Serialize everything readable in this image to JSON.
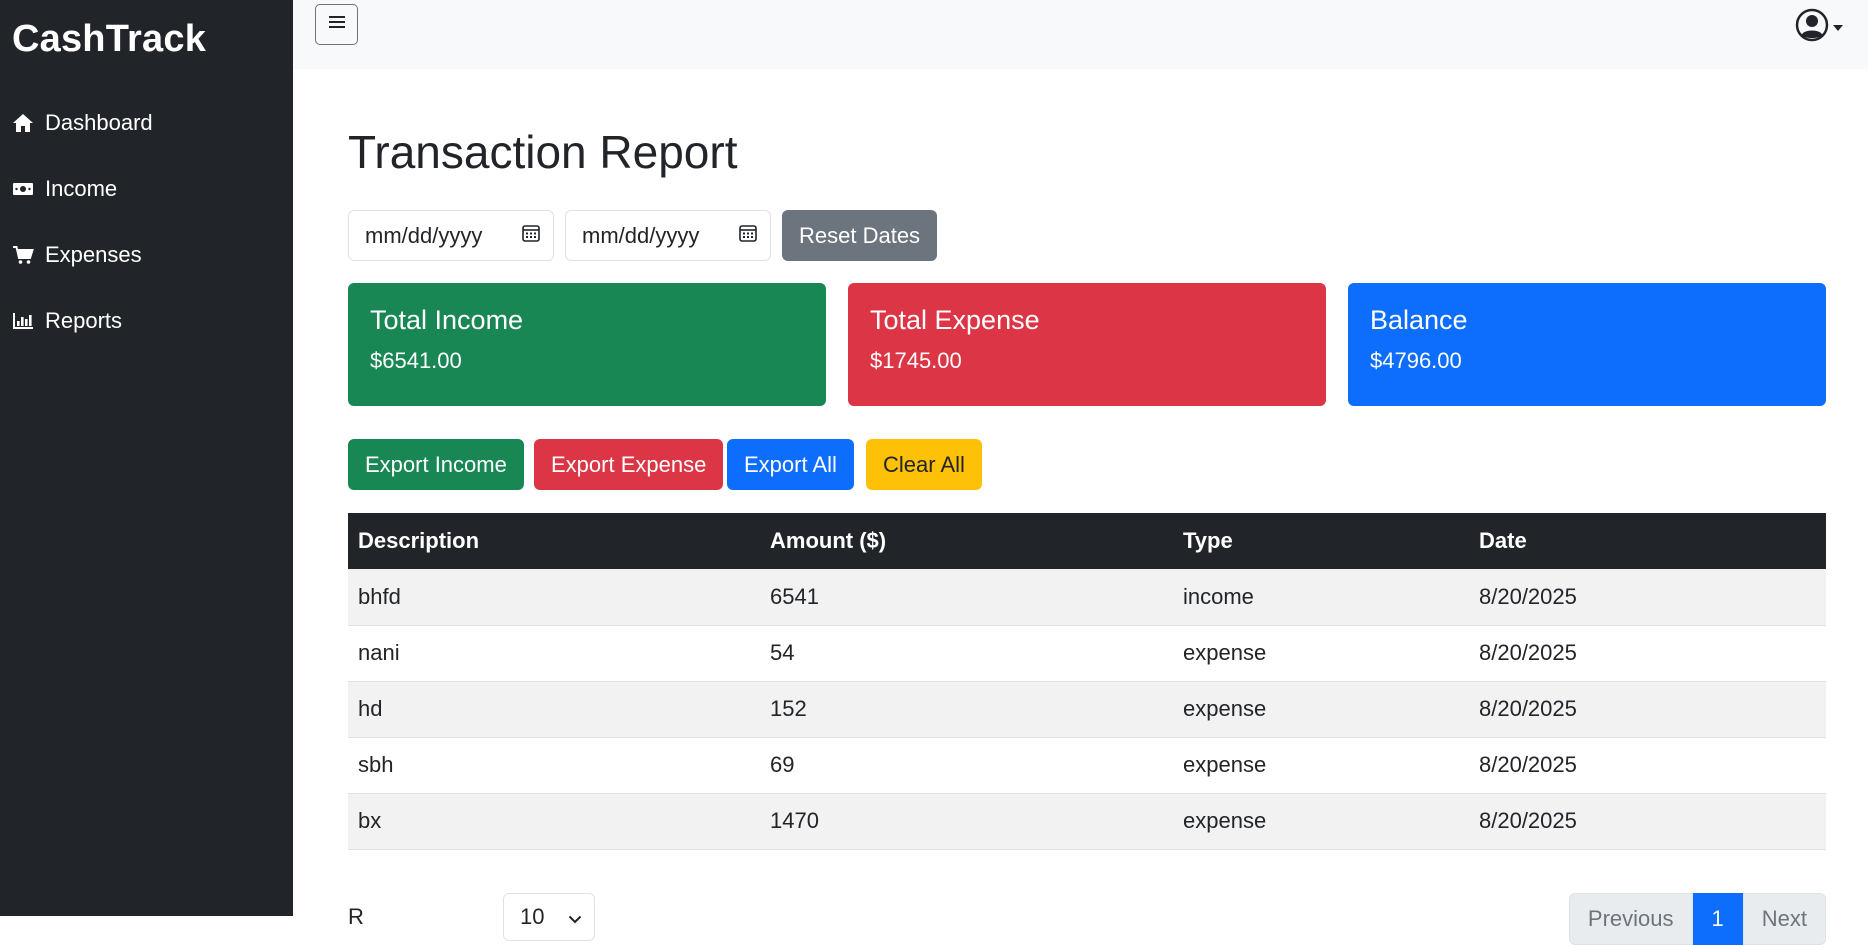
{
  "app": {
    "brand": "CashTrack"
  },
  "sidebar": {
    "items": [
      {
        "label": "Dashboard",
        "icon": "home-icon"
      },
      {
        "label": "Income",
        "icon": "money-bill-icon"
      },
      {
        "label": "Expenses",
        "icon": "cart-icon"
      },
      {
        "label": "Reports",
        "icon": "bar-chart-icon"
      }
    ]
  },
  "topbar": {
    "menu_icon": "hamburger-icon",
    "user_icon": "user-circle-icon",
    "dropdown_icon": "caret-down-icon"
  },
  "main": {
    "title": "Transaction Report",
    "filters": {
      "start_date_placeholder": "mm/dd/yyyy",
      "end_date_placeholder": "mm/dd/yyyy",
      "reset_label": "Reset Dates"
    },
    "cards": [
      {
        "title": "Total Income",
        "value": "$6541.00",
        "color": "#198754"
      },
      {
        "title": "Total Expense",
        "value": "$1745.00",
        "color": "#dc3545"
      },
      {
        "title": "Balance",
        "value": "$4796.00",
        "color": "#0d6efd"
      }
    ],
    "actions": {
      "export_income": "Export Income",
      "export_expense": "Export Expense",
      "export_all": "Export All",
      "clear_all": "Clear All"
    },
    "table": {
      "headers": [
        "Description",
        "Amount ($)",
        "Type",
        "Date"
      ],
      "rows": [
        [
          "bhfd",
          "6541",
          "income",
          "8/20/2025"
        ],
        [
          "nani",
          "54",
          "expense",
          "8/20/2025"
        ],
        [
          "hd",
          "152",
          "expense",
          "8/20/2025"
        ],
        [
          "sbh",
          "69",
          "expense",
          "8/20/2025"
        ],
        [
          "bx",
          "1470",
          "expense",
          "8/20/2025"
        ]
      ]
    },
    "pagination": {
      "rows_label": "R",
      "rows_per_page": "10",
      "previous_label": "Previous",
      "current_page": "1",
      "next_label": "Next"
    }
  },
  "colors": {
    "sidebar_bg": "#212529",
    "success": "#198754",
    "danger": "#dc3545",
    "primary": "#0d6efd",
    "warning": "#ffc107",
    "secondary": "#6c757d"
  }
}
